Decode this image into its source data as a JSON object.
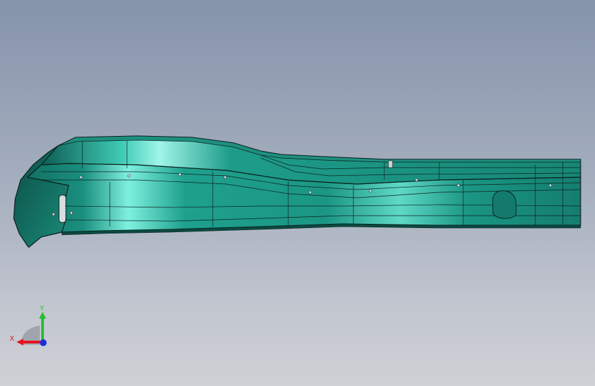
{
  "viewport": {
    "colors": {
      "part_fill": "#1f9e8c",
      "part_highlight": "#7ff0e0",
      "part_dark": "#0c5a4f",
      "edge": "#0b1f1c"
    }
  },
  "triad": {
    "x_label": "X",
    "y_label": "Y",
    "colors": {
      "x_axis": "#e8141b",
      "y_axis": "#21c12b",
      "z_axis": "#1d2fd8",
      "plane": "#9aa0a8"
    }
  }
}
